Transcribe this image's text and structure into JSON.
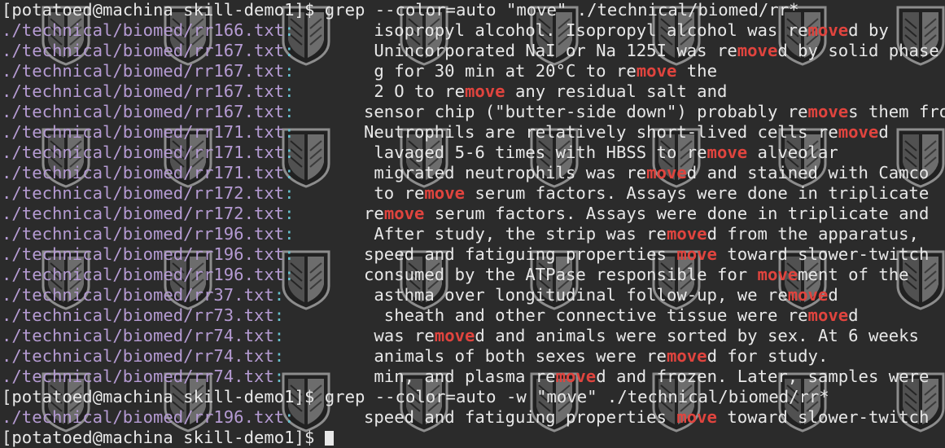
{
  "terminal": {
    "lines": [
      {
        "kind": "command",
        "prompt": "[potatoed@machina skill-demo1]$ ",
        "cmd": "grep --color=auto \"move\" ./technical/biomed/rr*"
      },
      {
        "kind": "match",
        "file": "./technical/biomed/rr166.txt",
        "sep": ":",
        "indent": 5,
        "pre": "isopropyl alcohol. Isopropyl alcohol was re",
        "match": "move",
        "post": "d by"
      },
      {
        "kind": "match",
        "file": "./technical/biomed/rr167.txt",
        "sep": ":",
        "indent": 5,
        "pre": "Unincorporated NaI or Na 125I was re",
        "match": "move",
        "post": "d by solid phase"
      },
      {
        "kind": "match",
        "file": "./technical/biomed/rr167.txt",
        "sep": ":",
        "indent": 5,
        "pre": "g for 30 min at 20°C to re",
        "match": "move",
        "post": " the"
      },
      {
        "kind": "match",
        "file": "./technical/biomed/rr167.txt",
        "sep": ":",
        "indent": 5,
        "pre": "2 O to re",
        "match": "move",
        "post": " any residual salt and"
      },
      {
        "kind": "match",
        "file": "./technical/biomed/rr167.txt",
        "sep": ":",
        "indent": 4,
        "pre": "sensor chip (\"butter-side down\") probably re",
        "match": "move",
        "post": "s them from"
      },
      {
        "kind": "match",
        "file": "./technical/biomed/rr171.txt",
        "sep": ":",
        "indent": 4,
        "pre": "Neutrophils are relatively short-lived cells re",
        "match": "move",
        "post": "d"
      },
      {
        "kind": "match",
        "file": "./technical/biomed/rr171.txt",
        "sep": ":",
        "indent": 5,
        "pre": "lavaged 5-6 times with HBSS to re",
        "match": "move",
        "post": " alveolar"
      },
      {
        "kind": "match",
        "file": "./technical/biomed/rr171.txt",
        "sep": ":",
        "indent": 5,
        "pre": "migrated neutrophils was re",
        "match": "move",
        "post": "d and stained with Camco"
      },
      {
        "kind": "match",
        "file": "./technical/biomed/rr172.txt",
        "sep": ":",
        "indent": 5,
        "pre": "to re",
        "match": "move",
        "post": " serum factors. Assays were done in triplicate"
      },
      {
        "kind": "match",
        "file": "./technical/biomed/rr172.txt",
        "sep": ":",
        "indent": 4,
        "pre": "re",
        "match": "move",
        "post": " serum factors. Assays were done in triplicate and"
      },
      {
        "kind": "match",
        "file": "./technical/biomed/rr196.txt",
        "sep": ":",
        "indent": 5,
        "pre": "After study, the strip was re",
        "match": "move",
        "post": "d from the apparatus,"
      },
      {
        "kind": "match",
        "file": "./technical/biomed/rr196.txt",
        "sep": ":",
        "indent": 4,
        "pre": "speed and fatiguing properties ",
        "match": "move",
        "post": " toward slower-twitch"
      },
      {
        "kind": "match",
        "file": "./technical/biomed/rr196.txt",
        "sep": ":",
        "indent": 4,
        "pre": "consumed by the ATPase responsible for ",
        "match": "move",
        "post": "ment of the"
      },
      {
        "kind": "match",
        "file": "./technical/biomed/rr37.txt",
        "sep": ":",
        "indent": 5,
        "pre": "asthma over longitudinal follow-up, we re",
        "match": "move",
        "post": "d"
      },
      {
        "kind": "match",
        "file": "./technical/biomed/rr73.txt",
        "sep": ":",
        "indent": 6,
        "pre": "sheath and other connective tissue were re",
        "match": "move",
        "post": "d"
      },
      {
        "kind": "match",
        "file": "./technical/biomed/rr74.txt",
        "sep": ":",
        "indent": 5,
        "pre": "was re",
        "match": "move",
        "post": "d and animals were sorted by sex. At 6 weeks"
      },
      {
        "kind": "match",
        "file": "./technical/biomed/rr74.txt",
        "sep": ":",
        "indent": 5,
        "pre": "animals of both sexes were re",
        "match": "move",
        "post": "d for study."
      },
      {
        "kind": "match",
        "file": "./technical/biomed/rr74.txt",
        "sep": ":",
        "indent": 5,
        "pre": "min, and plasma re",
        "match": "move",
        "post": "d and frozen. Later, samples were"
      },
      {
        "kind": "command",
        "prompt": "[potatoed@machina skill-demo1]$ ",
        "cmd": "grep --color=auto -w \"move\" ./technical/biomed/rr*"
      },
      {
        "kind": "match",
        "file": "./technical/biomed/rr196.txt",
        "sep": ":",
        "indent": 4,
        "pre": "speed and fatiguing properties ",
        "match": "move",
        "post": " toward slower-twitch"
      },
      {
        "kind": "cursor",
        "prompt": "[potatoed@machina skill-demo1]$ ",
        "cmd": ""
      }
    ]
  },
  "background": {
    "icon": "wings-of-freedom-emblem-icon"
  },
  "colors": {
    "background": "#2b2b2b",
    "text": "#e8e8e8",
    "filename": "#b59bd3",
    "separator": "#66c2cf",
    "match": "#e0443e"
  }
}
